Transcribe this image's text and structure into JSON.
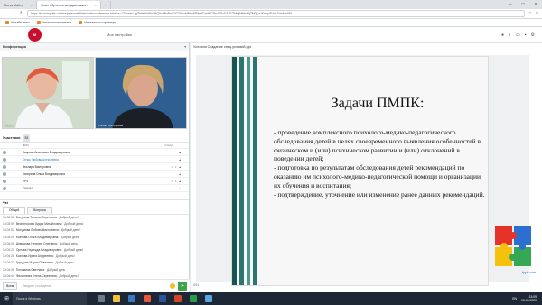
{
  "browser": {
    "tabs": [
      {
        "label": "Почта Mail.ru",
        "active": false
      },
      {
        "label": "Опыт обучения младших школ",
        "active": true
      }
    ],
    "url": "https://m.mirapolis.ru/mira/personal/flash/videoconference.html?a=12&user=IgGbbrWmRozBQ6uhNzNsiz2G25XoMNbsMFlm2Gnr%CShoM5vIJ3ZEOMwjM5bvRjZMQ_aJKmqv3Vs6J4mAkhM0",
    "bookmarks": [
      "Авиабилеты",
      "Часто посещаемые",
      "Начальная страница"
    ]
  },
  "app": {
    "my_settings": "Мои настройки",
    "conference_label": "Конференция",
    "slide_header": "Условия Создание спец.условий.ppt",
    "slide_number": "4/11"
  },
  "videos": [
    {
      "name": "Студия"
    },
    {
      "name": "Влюная Викторовна"
    }
  ],
  "participants": {
    "title": "Участники",
    "count": "53",
    "col_name": "ФИО",
    "col_status": "Статус",
    "rows": [
      {
        "name": "Заирова Анастасия Владимировна"
      },
      {
        "name": "Сечко Любовь Алексеевна"
      },
      {
        "name": "Эльнара Викторовна"
      },
      {
        "name": "Конорина Ольга Владимировна"
      },
      {
        "name": "УРЧ"
      },
      {
        "name": "СКШИ 8"
      }
    ]
  },
  "chat": {
    "title": "Чат",
    "tabs": [
      "Общий",
      "Вопросы"
    ],
    "messages": [
      {
        "time": "13:03:52",
        "name": "Батурина Татьяна Сергеевна:",
        "text": "Добрый день!"
      },
      {
        "time": "13:03:59",
        "name": "Веспоносова Лидия Михайловна:",
        "text": "Добрый день!"
      },
      {
        "time": "13:04:02",
        "name": "Митумова Любовь Викторовна:",
        "text": "Добрый день!"
      },
      {
        "time": "13:04:05",
        "name": "Козлова Ольга Владимировна:",
        "text": "Добрый день!"
      },
      {
        "time": "13:04:06",
        "name": "Демидова Наталия Олеговна:",
        "text": "Добрый день"
      },
      {
        "time": "13:04:20",
        "name": "Орлова Надежда Владимировна:",
        "text": "Добрый день!"
      },
      {
        "time": "13:04:26",
        "name": "Козлова Ирина Андреевна:",
        "text": "Добрый день!"
      },
      {
        "time": "13:04:33",
        "name": "Груздова Мария Павловна:",
        "text": "Добрый день"
      },
      {
        "time": "13:04:36",
        "name": "Пономина Светлана:",
        "text": "Добрый день"
      },
      {
        "time": "13:04:44",
        "name": "Филиппова Елена Сергеевна:",
        "text": "Добрый день!"
      }
    ],
    "recipient": "Всем",
    "input_placeholder": "Введите сообщение..."
  },
  "slide": {
    "title": "Задачи ПМПК:",
    "bullets": [
      "- проведение комплексного психолого-медико-педагогического обследования детей в целях своевременного выявления особенностей в физическом и (или) психическом развитии и (или) отклонений в поведении детей;",
      "- подготовка по результатам обследования детей рекомендаций по оказанию им психолого-медико-педагогической помощи и организации их обучения и воспитания;",
      "- подтверждение, уточнение или изменение ранее данных рекомендаций."
    ],
    "footer": "fppt.com"
  },
  "taskbar": {
    "search_placeholder": "Поиск в Windows",
    "lang": "EN",
    "time": "13:09",
    "date": "15.03.2020"
  },
  "colors": {
    "slide_stripe": "#2c7670",
    "brand_red": "#c8102e",
    "send_green": "#3fa34d"
  }
}
